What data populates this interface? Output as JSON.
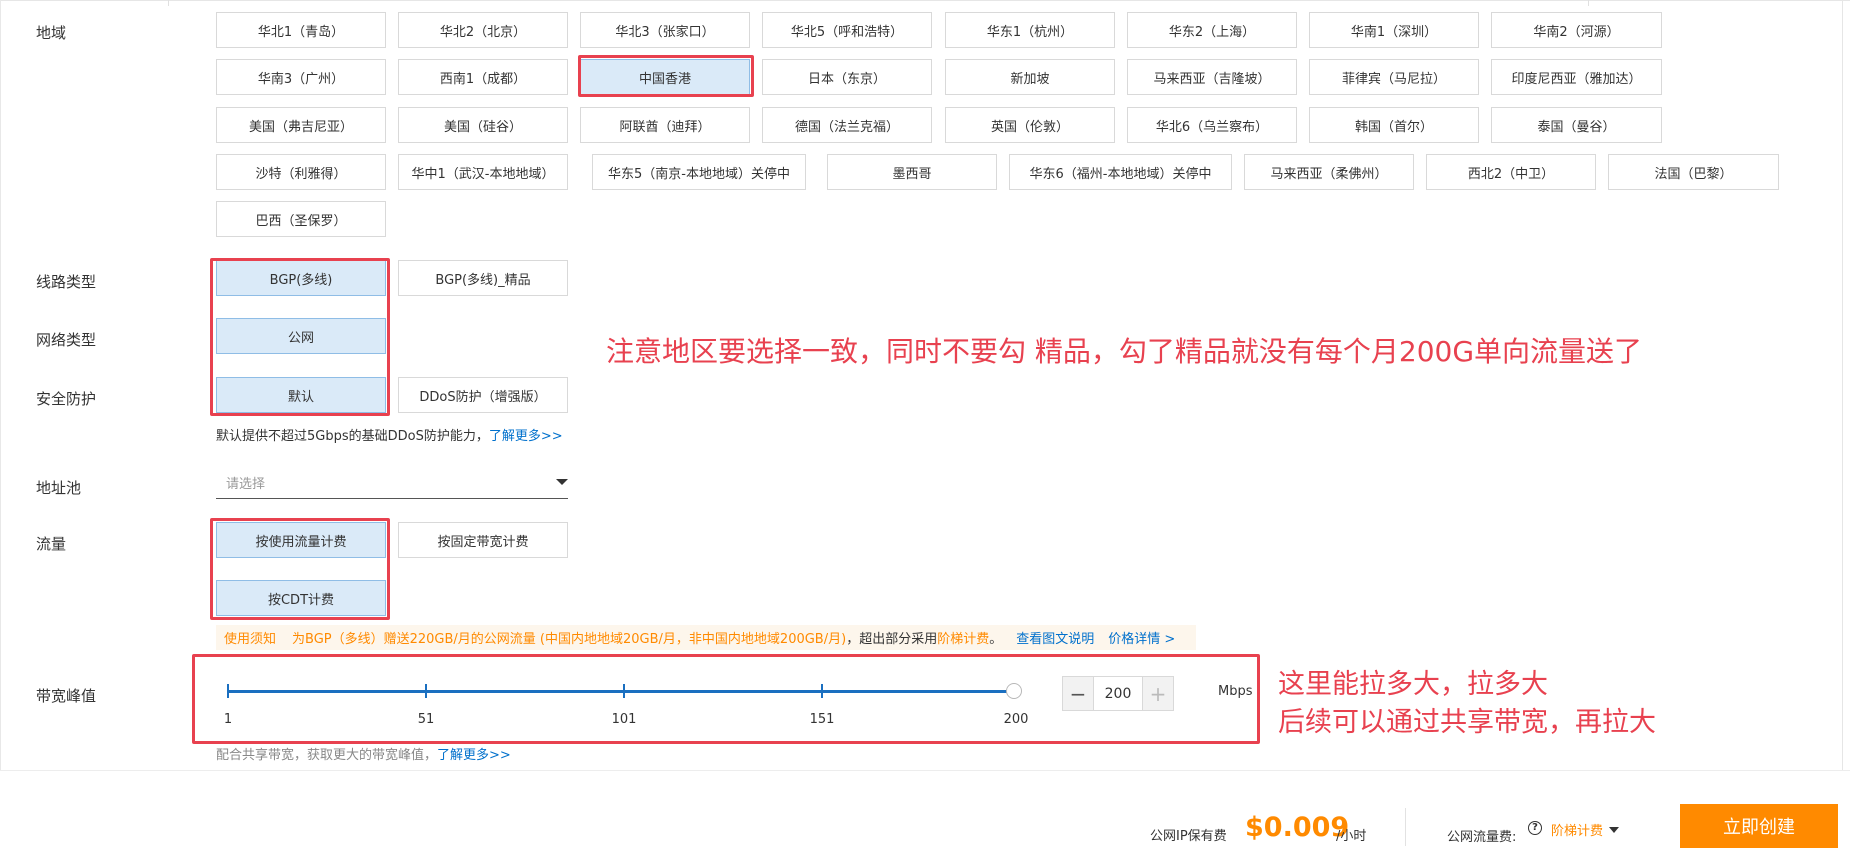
{
  "labels": {
    "region": "地域",
    "line_type": "线路类型",
    "network_type": "网络类型",
    "security": "安全防护",
    "address_pool": "地址池",
    "traffic": "流量",
    "bandwidth_peak": "带宽峰值"
  },
  "regions": [
    "华北1（青岛）",
    "华北2（北京）",
    "华北3（张家口）",
    "华北5（呼和浩特）",
    "华东1（杭州）",
    "华东2（上海）",
    "华南1（深圳）",
    "华南2（河源）",
    "华南3（广州）",
    "西南1（成都）",
    "中国香港",
    "日本（东京）",
    "新加坡",
    "马来西亚（吉隆坡）",
    "菲律宾（马尼拉）",
    "印度尼西亚（雅加达）",
    "美国（弗吉尼亚）",
    "美国（硅谷）",
    "阿联酋（迪拜）",
    "德国（法兰克福）",
    "英国（伦敦）",
    "华北6（乌兰察布）",
    "韩国（首尔）",
    "泰国（曼谷）",
    "沙特（利雅得）",
    "华中1（武汉-本地地域）",
    "华东5（南京-本地地域）关停中",
    "墨西哥",
    "华东6（福州-本地地域）关停中",
    "马来西亚（柔佛州）",
    "西北2（中卫）",
    "法国（巴黎）",
    "巴西（圣保罗）"
  ],
  "selected_region": "中国香港",
  "line_type_options": [
    "BGP(多线)",
    "BGP(多线)_精品"
  ],
  "line_type_selected": "BGP(多线)",
  "network_type_options": [
    "公网"
  ],
  "security_options": [
    "默认",
    "DDoS防护（增强版）"
  ],
  "security_hint": "默认提供不超过5Gbps的基础DDoS防护能力，",
  "security_link": "了解更多>>",
  "address_pool_placeholder": "请选择",
  "traffic_options": [
    "按使用流量计费",
    "按固定带宽计费",
    "按CDT计费"
  ],
  "notice": {
    "tag": "使用须知",
    "text": "为BGP（多线）赠送220GB/月的公网流量 (中国内地地域20GB/月，非中国内地地域200GB/月)",
    "text2": "，超出部分采用",
    "tier": "阶梯计费",
    "end": "。",
    "link1": "查看图文说明",
    "link2": "价格详情 >"
  },
  "bandwidth": {
    "ticks": [
      "1",
      "51",
      "101",
      "151",
      "200"
    ],
    "value": "200",
    "unit": "Mbps",
    "minus": "−",
    "plus": "+",
    "hint": "配合共享带宽，获取更大的带宽峰值，",
    "hint_link": "了解更多>>"
  },
  "annotations": {
    "main": "注意地区要选择一致，同时不要勾 精品，勾了精品就没有每个月200G单向流量送了",
    "bw_line1": "这里能拉多大，拉多大",
    "bw_line2": "后续可以通过共享带宽，再拉大"
  },
  "footer": {
    "ip_fee_label": "公网IP保有费",
    "price": "$0.009",
    "price_unit": "/小时",
    "traffic_fee_label": "公网流量费:",
    "q_mark": "?",
    "tier_link": "阶梯计费",
    "create_button": "立即创建"
  },
  "colors": {
    "selected_bg": "#daeaf8",
    "annotation_red": "#e8414f",
    "accent_orange": "#ff8a00",
    "link_blue": "#0070cc"
  }
}
